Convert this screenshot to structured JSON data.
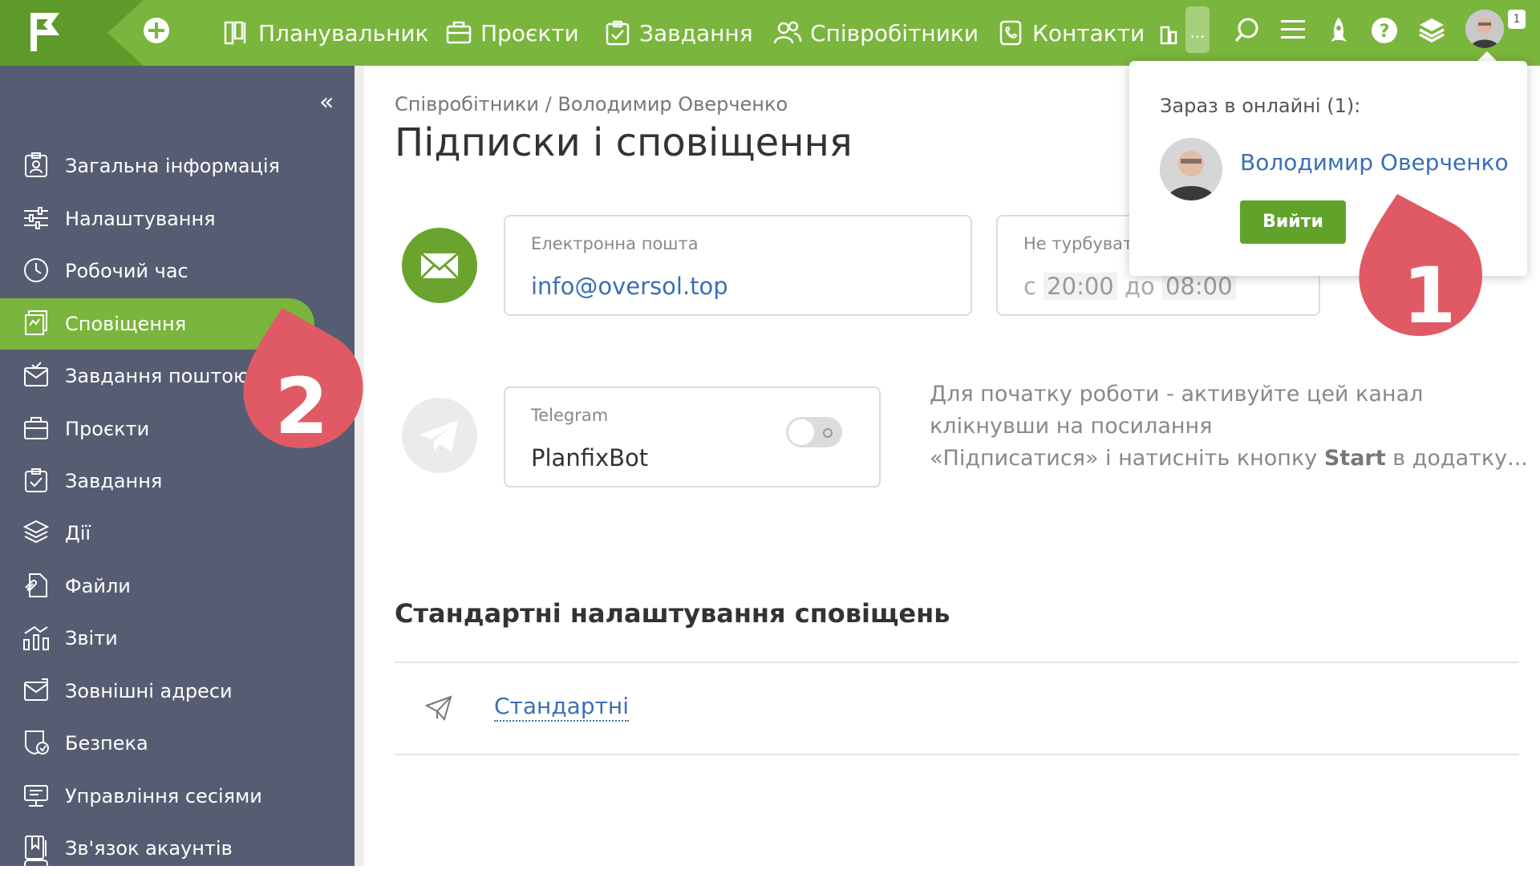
{
  "topbar": {
    "nav": [
      {
        "label": "Планувальник",
        "icon": "planner-icon"
      },
      {
        "label": "Проєкти",
        "icon": "projects-icon"
      },
      {
        "label": "Завдання",
        "icon": "tasks-icon"
      },
      {
        "label": "Співробітники",
        "icon": "employees-icon"
      },
      {
        "label": "Контакти",
        "icon": "contacts-icon"
      }
    ],
    "more_label": "...",
    "avatar_badge": "1",
    "accent": "#7ab53d",
    "logo_bg": "#5e9b2a"
  },
  "sidebar": {
    "collapse_label": "«",
    "items": [
      {
        "label": "Загальна інформація",
        "icon": "general-info-icon"
      },
      {
        "label": "Налаштування",
        "icon": "settings-sliders-icon"
      },
      {
        "label": "Робочий час",
        "icon": "clock-icon"
      },
      {
        "label": "Сповіщення",
        "icon": "notifications-icon",
        "active": true
      },
      {
        "label": "Завдання поштою",
        "icon": "mail-tasks-icon"
      },
      {
        "label": "Проєкти",
        "icon": "projects-icon"
      },
      {
        "label": "Завдання",
        "icon": "tasks-icon"
      },
      {
        "label": "Дії",
        "icon": "actions-layers-icon"
      },
      {
        "label": "Файли",
        "icon": "files-icon"
      },
      {
        "label": "Звіти",
        "icon": "reports-icon"
      },
      {
        "label": "Зовнішні адреси",
        "icon": "external-addresses-icon"
      },
      {
        "label": "Безпека",
        "icon": "security-icon"
      },
      {
        "label": "Управління сесіями",
        "icon": "sessions-icon"
      },
      {
        "label": "Зв'язок акаунтів",
        "icon": "account-link-icon"
      }
    ],
    "bg": "#565d72"
  },
  "main": {
    "breadcrumb": "Співробітники / Володимир Оверченко",
    "title": "Підписки і сповіщення",
    "email_card": {
      "label": "Електронна пошта",
      "value": "info@oversol.top"
    },
    "dnd_card": {
      "label": "Не турбуват",
      "prefix": "с",
      "from": "20:00",
      "middle": "до",
      "to": "08:00"
    },
    "telegram_card": {
      "label": "Telegram",
      "value": "PlanfixBot",
      "enabled": false
    },
    "hint": {
      "line1": "Для початку роботи - активуйте цей канал",
      "line2": "клікнувши на посилання",
      "line3_pre": "«Підписатися» і натисніть кнопку",
      "line3_bold": "Start",
      "line3_post": "в додатку..."
    },
    "section_title": "Стандартні налаштування сповіщень",
    "standard_link": "Стандартні"
  },
  "popup": {
    "title": "Зараз в онлайні (1):",
    "user": "Володимир Оверченко",
    "logout": "Вийти"
  },
  "markers": [
    "1",
    "2"
  ],
  "colors": {
    "marker": "#e05a66",
    "link": "#3a6fb5"
  }
}
